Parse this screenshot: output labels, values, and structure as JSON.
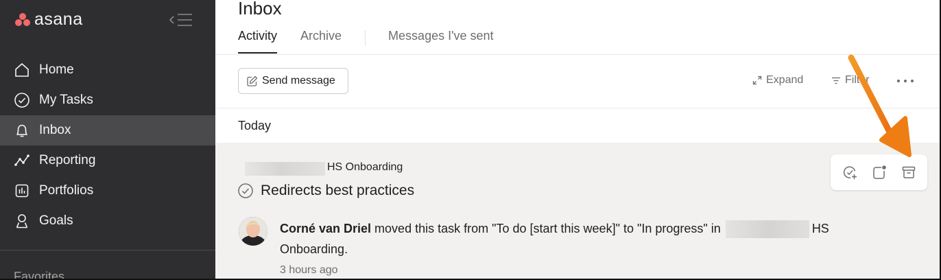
{
  "app": {
    "name": "asana"
  },
  "sidebar": {
    "items": [
      {
        "label": "Home",
        "icon": "home-icon"
      },
      {
        "label": "My Tasks",
        "icon": "check-circle-icon"
      },
      {
        "label": "Inbox",
        "icon": "bell-icon",
        "active": true
      },
      {
        "label": "Reporting",
        "icon": "chart-line-icon"
      },
      {
        "label": "Portfolios",
        "icon": "portfolio-icon"
      },
      {
        "label": "Goals",
        "icon": "person-icon"
      }
    ],
    "section_favorites": "Favorites"
  },
  "page": {
    "title": "Inbox",
    "tabs": [
      {
        "label": "Activity",
        "active": true
      },
      {
        "label": "Archive"
      },
      {
        "label": "Messages I've sent"
      }
    ]
  },
  "toolbar": {
    "send_message": "Send message",
    "expand": "Expand",
    "filter": "Filter"
  },
  "feed": {
    "group": "Today",
    "notification": {
      "project": "HS Onboarding",
      "task_title": "Redirects best practices",
      "actor": "Corné van Driel",
      "message_before": " moved this task from \"To do [start this week]\" to \"In progress\" in ",
      "message_project": "HS Onboarding.",
      "time": "3 hours ago"
    }
  },
  "colors": {
    "sidebar_bg": "#2e2e30",
    "sidebar_active": "#4a4a4c",
    "logo_coral": "#f06a6a",
    "annotation_arrow": "#f57f17"
  }
}
